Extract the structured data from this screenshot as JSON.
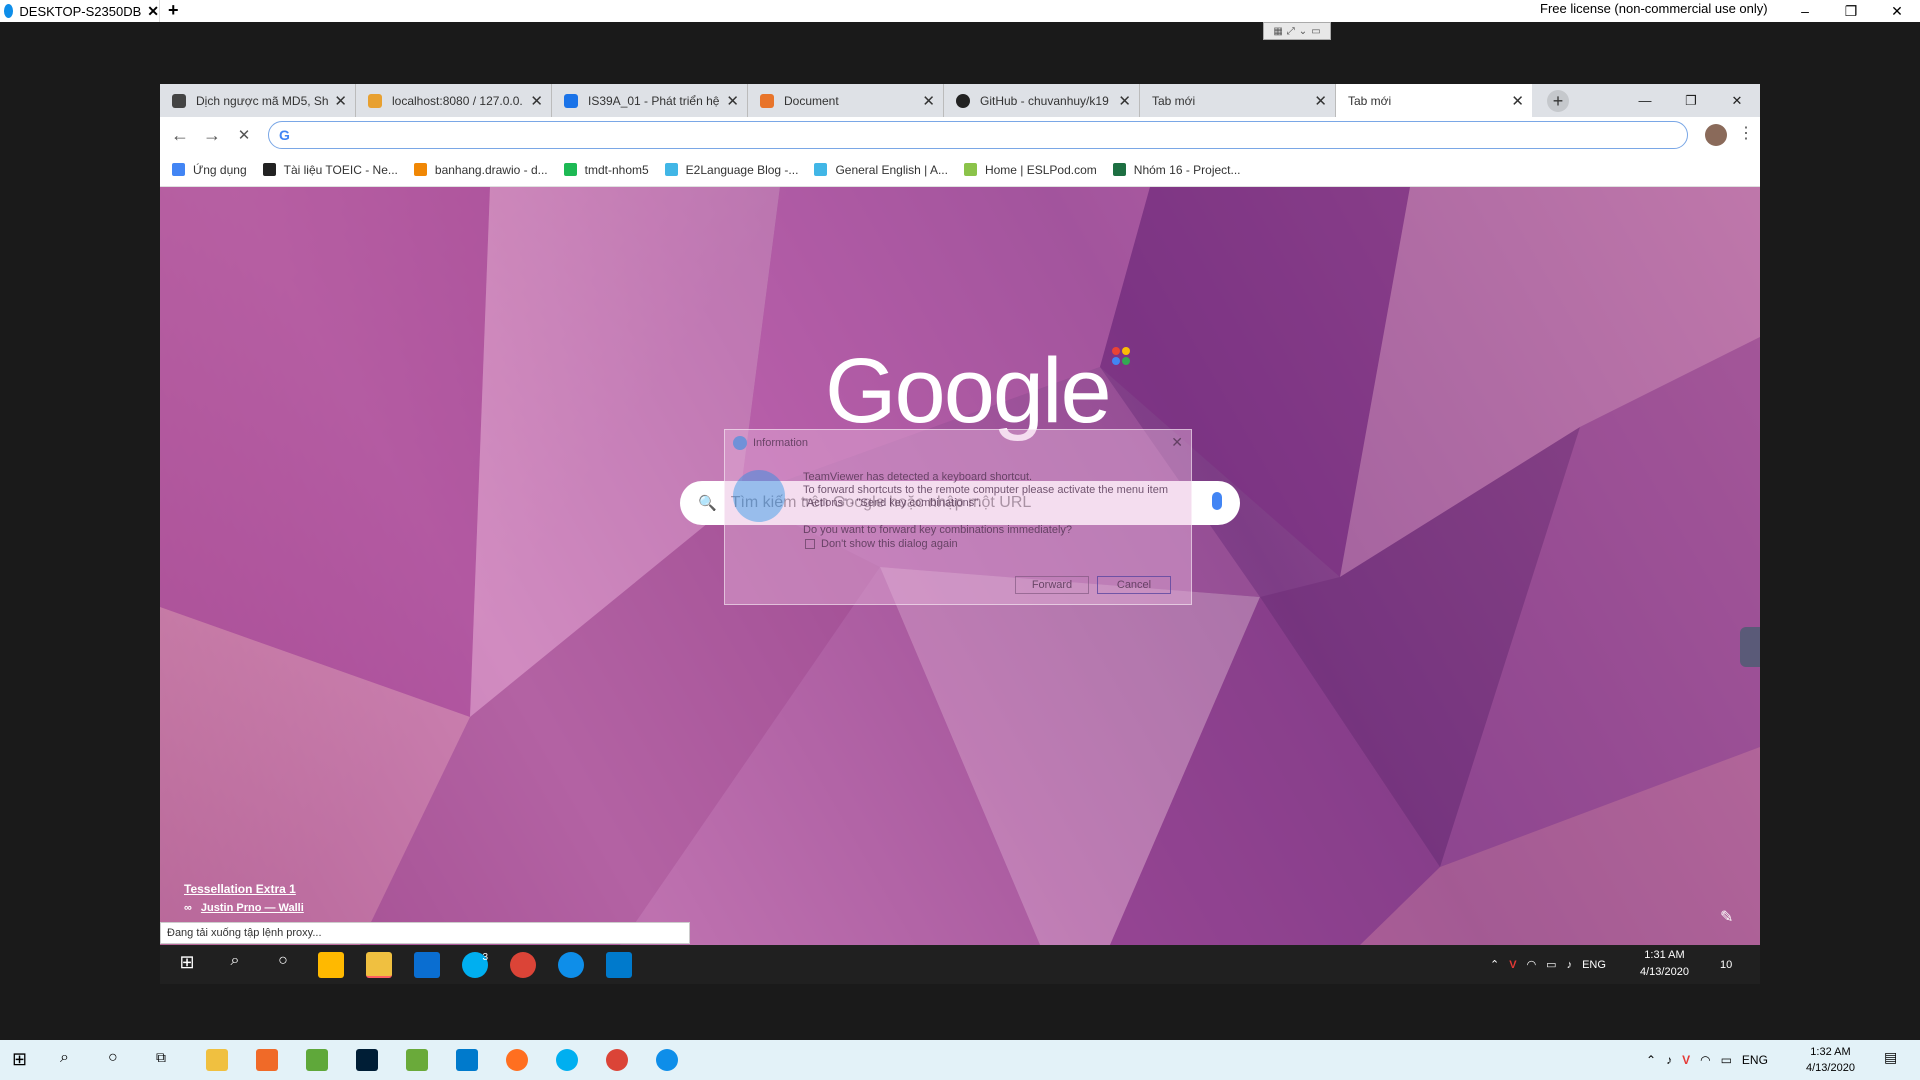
{
  "teamviewer": {
    "tab_label": "DESKTOP-S2350DB",
    "tab_close": "✕",
    "add_tab": "+",
    "license_text": "Free license (non-commercial use only)",
    "minimize": "–",
    "restore": "❐",
    "close": "✕"
  },
  "chrome": {
    "tabs": [
      {
        "title": "Dịch ngược mã MD5, Sh",
        "favicon_color": "#444444"
      },
      {
        "title": "localhost:8080 / 127.0.0.",
        "favicon_color": "#e8a030"
      },
      {
        "title": "IS39A_01 - Phát triển hệ",
        "favicon_color": "#1a73e8"
      },
      {
        "title": "Document",
        "favicon_color": "#e8742a"
      },
      {
        "title": "GitHub - chuvanhuy/k19",
        "favicon_color": "#222222"
      },
      {
        "title": "Tab mới",
        "favicon_color": "#dee1e6"
      },
      {
        "title": "Tab mới",
        "favicon_color": "#ffffff"
      }
    ],
    "tab_close_glyph": "✕",
    "new_tab_glyph": "+",
    "win_min": "—",
    "win_restore": "❐",
    "win_close": "✕",
    "back_glyph": "←",
    "forward_glyph": "→",
    "stop_glyph": "✕",
    "omnibox_value": "",
    "omnibox_icon": "G",
    "menu_glyph": "⋮",
    "bookmarks": [
      {
        "label": "Ứng dụng",
        "icon_color": "#4285f4"
      },
      {
        "label": "Tài liệu TOEIC - Ne...",
        "icon_color": "#222222"
      },
      {
        "label": "banhang.drawio - d...",
        "icon_color": "#f08705"
      },
      {
        "label": "tmdt-nhom5",
        "icon_color": "#1db954"
      },
      {
        "label": "E2Language Blog -...",
        "icon_color": "#41b6e6"
      },
      {
        "label": "General English | A...",
        "icon_color": "#41b6e6"
      },
      {
        "label": "Home | ESLPod.com",
        "icon_color": "#8bc34a"
      },
      {
        "label": "Nhóm 16 - Project...",
        "icon_color": "#1d6f42"
      }
    ]
  },
  "newtab": {
    "logo_text": "Google",
    "search_placeholder": "Tìm kiếm trên Google hoặc nhập một URL",
    "search_icon": "🔍",
    "bg_title": "Tessellation Extra 1",
    "bg_author_prefix": "∞",
    "bg_author": "Justin Prno — Walli",
    "edit_icon": "✎"
  },
  "dialog": {
    "title": "Information",
    "close_glyph": "✕",
    "line1": "TeamViewer has detected a keyboard shortcut.",
    "line2": "To forward shortcuts to the remote computer please activate the menu item",
    "line3": "\"Actions\" - \"Send key combinations\".",
    "line4": "Do you want to forward key combinations immediately?",
    "checkbox_label": "Don't show this dialog again",
    "forward_label": "Forward",
    "cancel_label": "Cancel"
  },
  "status": {
    "loading_text": "Đang tải xuống tập lệnh proxy..."
  },
  "remote_taskbar": {
    "tray_lang": "ENG",
    "time": "1:31 AM",
    "date": "4/13/2020",
    "skype_badge": "3",
    "notif_badge": "10"
  },
  "local_taskbar": {
    "tray_lang": "ENG",
    "time": "1:32 AM",
    "date": "4/13/2020"
  }
}
